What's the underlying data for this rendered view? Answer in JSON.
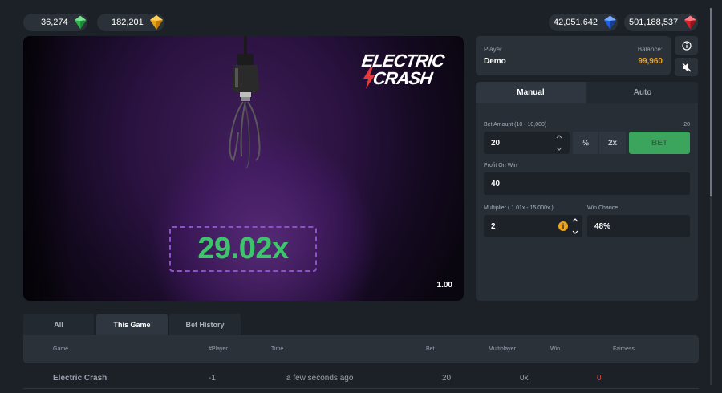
{
  "wallet": {
    "green_gems": "36,274",
    "yellow_gems": "182,201",
    "blue_gems": "42,051,642",
    "red_gems": "501,188,537"
  },
  "game": {
    "logo_line1": "ELECTRIC",
    "logo_line2": "CRASH",
    "multiplier": "29.02x",
    "round_value": "1.00"
  },
  "player": {
    "label": "Player",
    "name": "Demo",
    "balance_label": "Balance:",
    "balance": "99,960"
  },
  "tabs": {
    "manual": "Manual",
    "auto": "Auto"
  },
  "form": {
    "bet_amount_label": "Bet Amount (10 - 10,000)",
    "bet_amount_hint": "20",
    "bet_amount": "20",
    "half_label": "½",
    "double_label": "2x",
    "bet_button": "BET",
    "profit_label": "Profit On Win",
    "profit": "40",
    "multiplier_label": "Multiplier ( 1.01x - 15,000x )",
    "multiplier": "2",
    "win_chance_label": "Win Chance",
    "win_chance": "48%"
  },
  "history": {
    "tabs": [
      "All",
      "This Game",
      "Bet History"
    ],
    "columns": [
      "Game",
      "#Player",
      "Time",
      "Bet",
      "Multiplayer",
      "Win",
      "Fairness"
    ],
    "rows": [
      {
        "game": "Electric Crash",
        "player": "-1",
        "time": "a few seconds ago",
        "bet": "20",
        "multiplier": "0x",
        "win": "0"
      }
    ]
  },
  "colors": {
    "accent_green": "#3ec46a",
    "balance_orange": "#f0a31a",
    "win_red": "#e04a3a",
    "bet_button": "#3ba45d"
  },
  "icons": [
    "green-gem-icon",
    "yellow-gem-icon",
    "blue-gem-icon",
    "red-gem-icon",
    "info-icon",
    "sound-off-icon",
    "chevron-up-icon",
    "chevron-down-icon",
    "lightbulb-icon",
    "bolt-icon"
  ]
}
